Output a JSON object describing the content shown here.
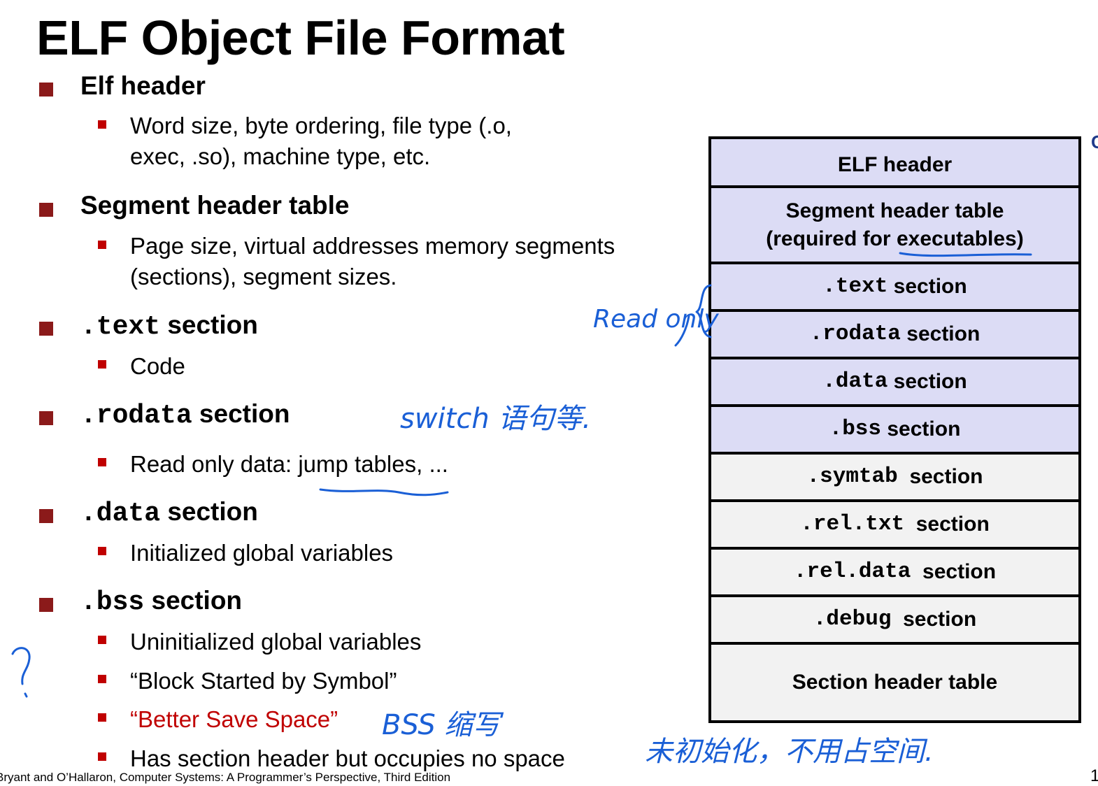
{
  "title": "ELF Object File Format",
  "bullets": {
    "elf_header": {
      "label": "Elf header",
      "sub": [
        "Word size, byte ordering, file type (.o,",
        "exec, .so), machine type, etc."
      ]
    },
    "segment_header": {
      "label": "Segment header table",
      "sub": [
        "Page size, virtual addresses memory segments",
        "(sections), segment sizes."
      ]
    },
    "text": {
      "code": ".text",
      "label": "section",
      "sub": "Code"
    },
    "rodata": {
      "code": ".rodata",
      "label": "section",
      "sub_before": "Read only data: ",
      "sub_underlined": "jump tables",
      "sub_after": ", ..."
    },
    "data": {
      "code": ".data",
      "label": "section",
      "sub": "Initialized global variables"
    },
    "bss": {
      "code": ".bss",
      "label": "section",
      "sub1": "Uninitialized global variables",
      "sub2": "“Block Started by Symbol”",
      "sub3": "“Better Save Space”",
      "sub4": "Has section header but occupies no space"
    }
  },
  "diagram": {
    "elf_header": "ELF header",
    "segment_line1": "Segment header table",
    "segment_line2_before": "(required for ",
    "segment_line2_underlined": "executables",
    "segment_line2_after": ")",
    "text_code": ".text",
    "text_label": "section",
    "rodata_code": ".rodata",
    "rodata_label": "section",
    "data_code": ".data",
    "data_label": "section",
    "bss_code": ".bss",
    "bss_label": "section",
    "symtab_code": ".symtab",
    "symtab_label": "section",
    "reltxt_code": ".rel.txt",
    "reltxt_label": "section",
    "reldata_code": ".rel.data",
    "reldata_label": "section",
    "debug_code": ".debug",
    "debug_label": "section",
    "section_header": "Section header table"
  },
  "annotations": {
    "read_only": "Read only",
    "switch_note": "switch 语句等.",
    "bss_abbrev": "BSS 缩写",
    "uninit_note": "未初始化，不用占空间.",
    "question": "?"
  },
  "footer": "Bryant and O’Hallaron, Computer Systems: A Programmer’s Perspective, Third Edition",
  "page_number": "1",
  "edge_mark": "C",
  "colors": {
    "bullet_main": "#8b1a1a",
    "bullet_sub": "#c00000",
    "accent_red": "#c00000",
    "ink_blue": "#1a5fd6",
    "header_fill": "#dcdcf5",
    "section_fill": "#f2f2f2"
  }
}
